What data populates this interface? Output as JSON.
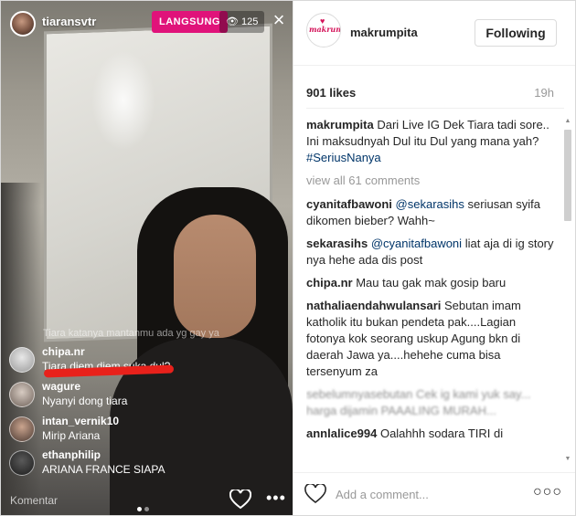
{
  "live": {
    "host_name": "tiaransvtr",
    "badge": "LANGSUNG",
    "viewers": "125",
    "close_glyph": "×",
    "faded_comment": "Tiara katanya mantanmu ada yg gay ya",
    "comments": [
      {
        "user": "chipa.nr",
        "text": "Tiara diem diem suka dul?"
      },
      {
        "user": "wagure",
        "text": "Nyanyi dong tiara"
      },
      {
        "user": "intan_vernik10",
        "text": "Mirip Ariana"
      },
      {
        "user": "ethanphilip",
        "text": "ARIANA FRANCE SIAPA"
      }
    ],
    "comment_placeholder": "Komentar",
    "icons": {
      "viewers": "eye-icon",
      "like": "heart-icon",
      "more": "more-icon",
      "close": "close-icon"
    }
  },
  "post": {
    "account": "makrumpita",
    "avatar_logo_text": "makrumpita",
    "follow_label": "Following",
    "likes": "901 likes",
    "age": "19h",
    "caption": {
      "user": "makrumpita",
      "line1": "Dari Live IG Dek Tiara tadi sore..",
      "line2": "Ini maksudnyah Dul itu Dul yang mana yah?",
      "hashtag": "#SeriusNanya"
    },
    "view_all": "view all 61 comments",
    "comments": [
      {
        "user": "cyanitafbawoni",
        "mention": "@sekarasihs",
        "text": "seriusan syifa dikomen bieber? Wahh~"
      },
      {
        "user": "sekarasihs",
        "mention": "@cyanitafbawoni",
        "text": "liat aja di ig story nya hehe ada dis post"
      },
      {
        "user": "chipa.nr",
        "mention": "",
        "text": "Mau tau gak mak gosip baru"
      },
      {
        "user": "nathaliaendahwulansari",
        "mention": "",
        "text": "Sebutan imam katholik itu bukan pendeta pak....Lagian fotonya kok seorang uskup Agung bkn di daerah Jawa ya....hehehe cuma bisa tersenyum za"
      },
      {
        "user": "annlalice994",
        "mention": "",
        "text": "Oalahhh sodara TIRI di"
      }
    ],
    "blurred_comment": "sebelumnyasebutan Cek ig kami yuk say... harga dijamin PAAALING MURAH...",
    "add_comment_placeholder": "Add a comment...",
    "icons": {
      "like": "heart-outline-icon",
      "more": "more-icon"
    }
  },
  "colors": {
    "live_badge": "#e0137a",
    "link": "#003569",
    "red_annotation": "#e8211b"
  }
}
